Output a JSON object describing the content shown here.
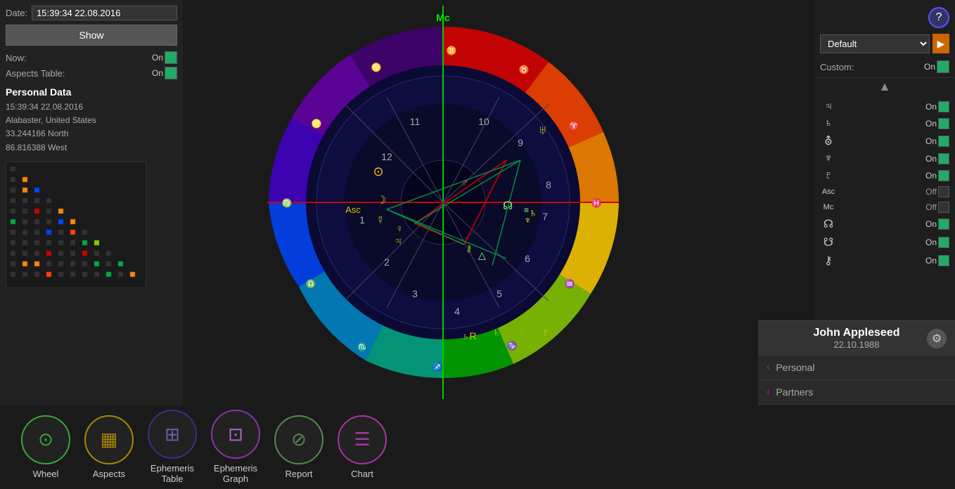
{
  "left": {
    "date_label": "Date:",
    "date_value": "15:39:34 22.08.2016",
    "show_btn": "Show",
    "now_label": "Now:",
    "now_value": "On",
    "aspects_table_label": "Aspects Table:",
    "aspects_table_value": "On",
    "personal": {
      "title": "Personal Data",
      "datetime": "15:39:34 22.08.2016",
      "location": "Alabaster, United States",
      "lat": "33.244166 North",
      "lon": "86.816388 West"
    }
  },
  "right": {
    "help_label": "?",
    "default_option": "Default",
    "custom_label": "Custom:",
    "custom_value": "On",
    "up_arrow": "▲",
    "planets": [
      {
        "symbol": "♃",
        "label": "Jupiter",
        "value": "On",
        "on": true
      },
      {
        "symbol": "♄",
        "label": "Saturn",
        "value": "On",
        "on": true
      },
      {
        "symbol": "⛢",
        "label": "Uranus",
        "value": "On",
        "on": true
      },
      {
        "symbol": "♆",
        "label": "Neptune",
        "value": "On",
        "on": true
      },
      {
        "symbol": "♇",
        "label": "Pluto",
        "value": "On",
        "on": true
      },
      {
        "symbol": "Asc",
        "label": "Asc",
        "value": "Off",
        "on": false
      },
      {
        "symbol": "Mc",
        "label": "Mc",
        "value": "Off",
        "on": false
      },
      {
        "symbol": "☊",
        "label": "Node",
        "value": "On",
        "on": true
      },
      {
        "symbol": "☋",
        "label": "SNode",
        "value": "On",
        "on": true
      },
      {
        "symbol": "⚷",
        "label": "Chiron",
        "value": "On",
        "on": true
      }
    ]
  },
  "bottom_nav": [
    {
      "label": "Wheel",
      "icon": "⊙",
      "border_color": "#3a3"
    },
    {
      "label": "Aspects",
      "icon": "▦",
      "border_color": "#a80"
    },
    {
      "label": "Ephemeris\nTable",
      "icon": "⊞",
      "border_color": "#338"
    },
    {
      "label": "Ephemeris\nGraph",
      "icon": "⊡",
      "border_color": "#83a"
    },
    {
      "label": "Report",
      "icon": "⊘",
      "border_color": "#585"
    },
    {
      "label": "Chart",
      "icon": "☰",
      "border_color": "#a3a"
    }
  ],
  "user_card": {
    "name": "John Appleseed",
    "date": "22.10.1988",
    "gear_icon": "⚙",
    "rows": [
      {
        "label": "Personal"
      },
      {
        "label": "Partners"
      }
    ]
  }
}
